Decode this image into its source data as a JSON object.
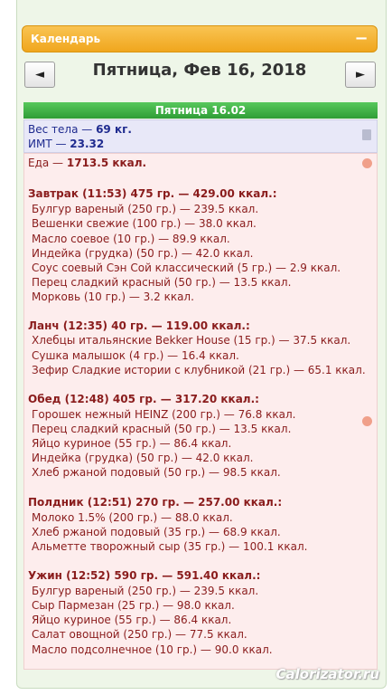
{
  "calendar": {
    "title": "Календарь",
    "collapse_icon": "minus-icon"
  },
  "nav": {
    "prev": "◄",
    "next": "►",
    "date": "Пятница, Фев 16, 2018"
  },
  "day_band": "Пятница 16.02",
  "body": {
    "weight_label": "Вес тела — ",
    "weight_value": "69 кг.",
    "bmi_label": "ИМТ — ",
    "bmi_value": "23.32"
  },
  "food_total": {
    "label": "Еда — ",
    "value": "1713.5 ккал."
  },
  "meals": [
    {
      "title": "Завтрак (11:53) 475 гр. — 429.00 ккал.:",
      "items": [
        "Булгур вареный (250 гр.) — 239.5 ккал.",
        "Вешенки свежие (100 гр.) — 38.0 ккал.",
        "Масло соевое (10 гр.) — 89.9 ккал.",
        "Индейка (грудка) (50 гр.) — 42.0 ккал.",
        "Соус соевый Сэн Сой классический (5 гр.) — 2.9 ккал.",
        "Перец сладкий красный (50 гр.) — 13.5 ккал.",
        "Морковь (10 гр.) — 3.2 ккал."
      ]
    },
    {
      "title": "Ланч (12:35) 40 гр. — 119.00 ккал.:",
      "items": [
        "Хлебцы итальянские Bekker House (15 гр.) — 37.5 ккал.",
        "Сушка малышок (4 гр.) — 16.4 ккал.",
        "Зефир Сладкие истории с клубникой (21 гр.) — 65.1 ккал."
      ]
    },
    {
      "title": "Обед (12:48) 405 гр. — 317.20 ккал.:",
      "items": [
        "Горошек нежный HEINZ (200 гр.) — 76.8 ккал.",
        "Перец сладкий красный (50 гр.) — 13.5 ккал.",
        "Яйцо куриное (55 гр.) — 86.4 ккал.",
        "Индейка (грудка) (50 гр.) — 42.0 ккал.",
        "Хлеб ржаной подовый (50 гр.) — 98.5 ккал."
      ]
    },
    {
      "title": "Полдник (12:51) 270 гр. — 257.00 ккал.:",
      "items": [
        "Молоко 1.5% (200 гр.) — 88.0 ккал.",
        "Хлеб ржаной подовый (35 гр.) — 68.9 ккал.",
        "Альметте творожный сыр (35 гр.) — 100.1 ккал."
      ]
    },
    {
      "title": "Ужин (12:52) 590 гр. — 591.40 ккал.:",
      "items": [
        "Булгур вареный (250 гр.) — 239.5 ккал.",
        "Сыр Пармезан (25 гр.) — 98.0 ккал.",
        "Яйцо куриное (55 гр.) — 86.4 ккал.",
        "Салат овощной (250 гр.) — 77.5 ккал.",
        "Масло подсолнечное (10 гр.) — 90.0 ккал."
      ]
    }
  ],
  "watermark": "Calorizator.ru"
}
